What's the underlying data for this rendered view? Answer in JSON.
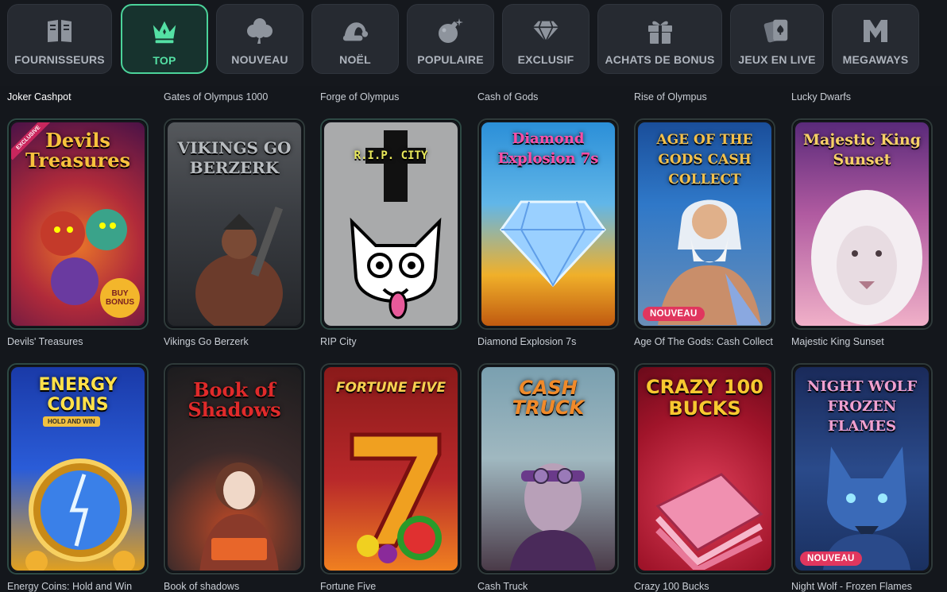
{
  "categories": [
    {
      "label": "FOURNISSEURS",
      "icon": "book-icon",
      "active": false
    },
    {
      "label": "TOP",
      "icon": "crown-icon",
      "active": true
    },
    {
      "label": "NOUVEAU",
      "icon": "clover-icon",
      "active": false
    },
    {
      "label": "NOËL",
      "icon": "santa-hat-icon",
      "active": false
    },
    {
      "label": "POPULAIRE",
      "icon": "bomb-icon",
      "active": false
    },
    {
      "label": "EXCLUSIF",
      "icon": "diamond-icon",
      "active": false
    },
    {
      "label": "ACHATS DE BONUS",
      "icon": "gift-icon",
      "active": false
    },
    {
      "label": "JEUX EN LIVE",
      "icon": "playing-cards-icon",
      "active": false
    },
    {
      "label": "MEGAWAYS",
      "icon": "megaways-m-icon",
      "active": false
    }
  ],
  "previous_row_titles": [
    "Joker Cashpot",
    "Gates of Olympus 1000",
    "Forge of Olympus",
    "Cash of Gods",
    "Rise of Olympus",
    "Lucky Dwarfs"
  ],
  "games_row1": [
    {
      "name": "Devils' Treasures",
      "art_title": "Devils Treasures",
      "exclusive_label": "EXCLUSIVE",
      "extra_art": "BUY BONUS"
    },
    {
      "name": "Vikings Go Berzerk",
      "art_title": "VIKINGS GO BERZERK"
    },
    {
      "name": "RIP City",
      "art_title": "R.I.P. CITY"
    },
    {
      "name": "Diamond Explosion 7s",
      "art_title": "Diamond Explosion 7s"
    },
    {
      "name": "Age Of The Gods: Cash Collect",
      "art_title": "AGE OF THE GODS CASH COLLECT",
      "badge": "NOUVEAU"
    },
    {
      "name": "Majestic King Sunset",
      "art_title": "Majestic King Sunset"
    }
  ],
  "games_row2": [
    {
      "name": "Energy Coins: Hold and Win",
      "art_title": "ENERGY COINS",
      "extra_art": "HOLD AND WIN"
    },
    {
      "name": "Book of shadows",
      "art_title": "Book of Shadows"
    },
    {
      "name": "Fortune Five",
      "art_title": "FORTUNE FIVE"
    },
    {
      "name": "Cash Truck",
      "art_title": "CASH TRUCK"
    },
    {
      "name": "Crazy 100 Bucks",
      "art_title": "CRAZY 100 BUCKS"
    },
    {
      "name": "Night Wolf - Frozen Flames",
      "art_title": "NIGHT WOLF FROZEN FLAMES",
      "badge": "NOUVEAU"
    }
  ],
  "colors": {
    "accent": "#4bd39a",
    "badge": "#e0365e",
    "background": "#14171c",
    "card": "#262a31"
  }
}
